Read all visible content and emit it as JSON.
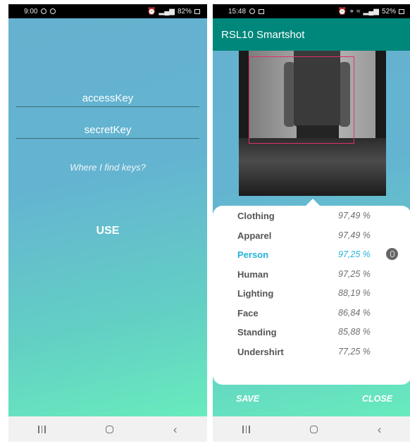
{
  "left": {
    "status": {
      "time": "9:00",
      "battery": "82%"
    },
    "access_key_placeholder": "accessKey",
    "secret_key_placeholder": "secretKey",
    "find_keys_link": "Where I find keys?",
    "use_button": "USE"
  },
  "right": {
    "status": {
      "time": "15:48",
      "battery": "52%"
    },
    "app_title": "RSL10 Smartshot",
    "labels": [
      {
        "name": "Clothing",
        "confidence": "97,49 %"
      },
      {
        "name": "Apparel",
        "confidence": "97,49 %"
      },
      {
        "name": "Person",
        "confidence": "97,25 %"
      },
      {
        "name": "Human",
        "confidence": "97,25 %"
      },
      {
        "name": "Lighting",
        "confidence": "88,19 %"
      },
      {
        "name": "Face",
        "confidence": "86,84 %"
      },
      {
        "name": "Standing",
        "confidence": "85,88 %"
      },
      {
        "name": "Undershirt",
        "confidence": "77,25 %"
      }
    ],
    "save_button": "SAVE",
    "close_button": "CLOSE"
  },
  "colors": {
    "accent_teal": "#00877b",
    "highlight": "#25b3d8",
    "box": "#e0306a"
  },
  "icons": [
    "camera-icon",
    "instagram-icon",
    "alarm-icon",
    "location-icon",
    "wifi-icon",
    "signal-icon",
    "battery-icon",
    "mic-icon",
    "recent-apps-icon",
    "home-icon",
    "back-icon"
  ]
}
